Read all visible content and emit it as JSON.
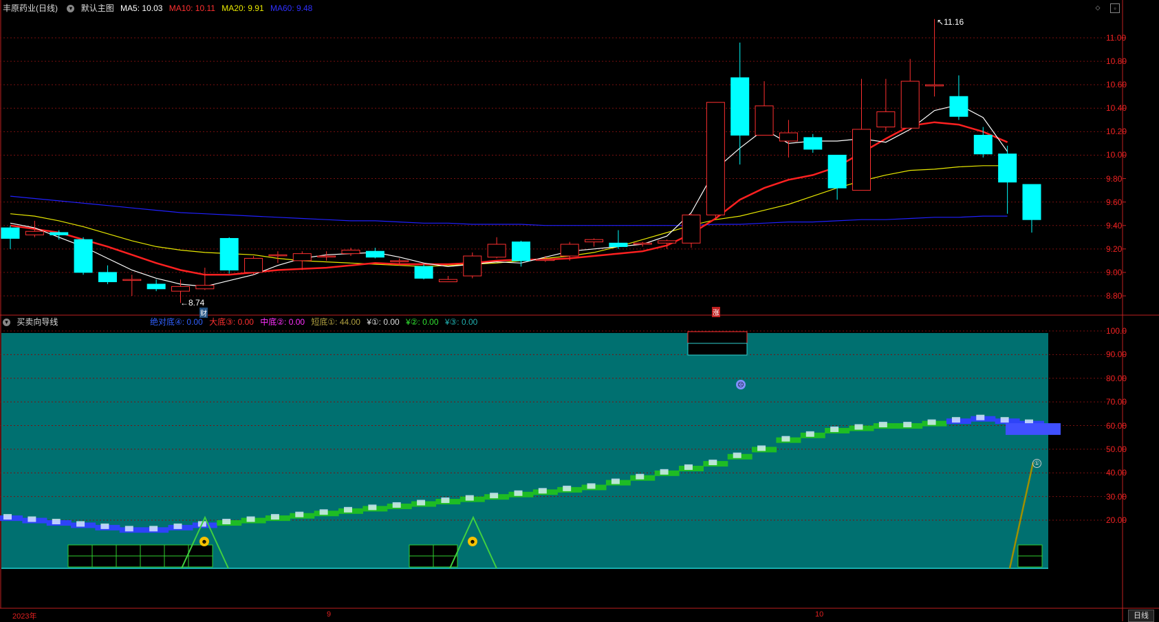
{
  "top_header": {
    "stock": "丰原药业(日线)",
    "chart_name": "默认主图",
    "ma5": "MA5: 10.03",
    "ma10": "MA10: 10.11",
    "ma20": "MA20: 9.91",
    "ma60": "MA60: 9.48"
  },
  "sub_header": {
    "indicator": "买卖向导线",
    "v1": "绝对底④: 0.00",
    "v2": "大底③: 0.00",
    "v3": "中底②: 0.00",
    "v4": "短底①: 44.00",
    "v5": "¥①: 0.00",
    "v6": "¥②: 0.00",
    "v7": "¥③: 0.00"
  },
  "colors": {
    "ma5": "#ffffff",
    "ma10": "#ff2020",
    "ma20": "#e8e800",
    "ma60": "#2020ff",
    "up": "#ff3030",
    "down": "#00ffff",
    "panel": "#007070"
  },
  "price_axis": [
    "11.00",
    "10.80",
    "10.60",
    "10.40",
    "10.20",
    "10.00",
    "9.80",
    "9.60",
    "9.40",
    "9.20",
    "9.00",
    "8.80"
  ],
  "indicator_axis": [
    "100.0",
    "90.00",
    "80.00",
    "70.00",
    "60.00",
    "50.00",
    "40.00",
    "30.00",
    "20.00"
  ],
  "date_labels": [
    "2023年",
    "9",
    "10"
  ],
  "annotations": {
    "high": "11.16",
    "low": "8.74",
    "cai": "财",
    "zhang": "涨",
    "marker1": "①"
  },
  "period_button": "日线",
  "chart_data": {
    "type": "candlestick",
    "ylim": [
      8.7,
      11.2
    ],
    "candles": [
      [
        9.38,
        9.29,
        9.4,
        9.2
      ],
      [
        9.32,
        9.35,
        9.44,
        9.3
      ],
      [
        9.34,
        9.32,
        9.36,
        9.28
      ],
      [
        9.28,
        9.0,
        9.3,
        8.98
      ],
      [
        9.0,
        8.92,
        9.06,
        8.9
      ],
      [
        8.94,
        8.94,
        8.98,
        8.8
      ],
      [
        8.9,
        8.86,
        8.94,
        8.84
      ],
      [
        8.84,
        8.88,
        8.94,
        8.74
      ],
      [
        8.86,
        8.89,
        9.04,
        8.85
      ],
      [
        9.29,
        9.02,
        9.3,
        8.99
      ],
      [
        9.0,
        9.12,
        9.14,
        8.98
      ],
      [
        9.15,
        9.15,
        9.18,
        9.08
      ],
      [
        9.1,
        9.16,
        9.18,
        9.02
      ],
      [
        9.14,
        9.14,
        9.18,
        9.1
      ],
      [
        9.16,
        9.19,
        9.21,
        9.14
      ],
      [
        9.18,
        9.13,
        9.21,
        9.12
      ],
      [
        9.1,
        9.1,
        9.12,
        9.06
      ],
      [
        9.05,
        8.95,
        9.07,
        8.94
      ],
      [
        8.92,
        8.94,
        8.97,
        8.92
      ],
      [
        8.97,
        9.14,
        9.17,
        8.95
      ],
      [
        9.13,
        9.24,
        9.3,
        9.12
      ],
      [
        9.26,
        9.1,
        9.27,
        9.05
      ],
      [
        9.11,
        9.11,
        9.14,
        9.09
      ],
      [
        9.14,
        9.24,
        9.26,
        9.1
      ],
      [
        9.26,
        9.28,
        9.29,
        9.22
      ],
      [
        9.25,
        9.22,
        9.36,
        9.2
      ],
      [
        9.24,
        9.25,
        9.26,
        9.22
      ],
      [
        9.25,
        9.27,
        9.28,
        9.2
      ],
      [
        9.25,
        9.49,
        9.5,
        9.21
      ],
      [
        9.49,
        10.45,
        10.45,
        9.45
      ],
      [
        10.66,
        10.17,
        10.96,
        9.92
      ],
      [
        10.17,
        10.42,
        10.63,
        10.17
      ],
      [
        10.12,
        10.19,
        10.3,
        9.98
      ],
      [
        10.15,
        10.05,
        10.18,
        10.02
      ],
      [
        10.0,
        9.72,
        10.0,
        9.62
      ],
      [
        9.7,
        10.22,
        10.65,
        9.7
      ],
      [
        10.24,
        10.37,
        10.65,
        10.2
      ],
      [
        10.23,
        10.63,
        10.82,
        10.22
      ],
      [
        10.59,
        10.6,
        11.16,
        10.5
      ],
      [
        10.5,
        10.33,
        10.68,
        10.3
      ],
      [
        10.17,
        10.01,
        10.24,
        9.98
      ],
      [
        10.01,
        9.77,
        10.08,
        9.5
      ],
      [
        9.75,
        9.45,
        9.75,
        9.34
      ]
    ],
    "ma5": [
      9.42,
      9.38,
      9.3,
      9.22,
      9.12,
      9.02,
      8.95,
      8.9,
      8.88,
      8.93,
      8.98,
      9.06,
      9.12,
      9.15,
      9.16,
      9.17,
      9.13,
      9.08,
      9.05,
      9.07,
      9.09,
      9.08,
      9.13,
      9.18,
      9.2,
      9.22,
      9.24,
      9.31,
      9.51,
      9.88,
      10.06,
      10.22,
      10.1,
      10.12,
      10.12,
      10.14,
      10.11,
      10.22,
      10.38,
      10.43,
      10.32,
      10.03
    ],
    "ma10": [
      9.4,
      9.37,
      9.34,
      9.28,
      9.22,
      9.15,
      9.08,
      9.02,
      8.98,
      8.98,
      9.0,
      9.02,
      9.03,
      9.04,
      9.06,
      9.08,
      9.07,
      9.07,
      9.07,
      9.08,
      9.1,
      9.11,
      9.11,
      9.12,
      9.14,
      9.16,
      9.18,
      9.23,
      9.33,
      9.46,
      9.62,
      9.72,
      9.79,
      9.83,
      9.9,
      10.02,
      10.14,
      10.25,
      10.28,
      10.26,
      10.2,
      10.11
    ],
    "ma20": [
      9.5,
      9.48,
      9.44,
      9.39,
      9.33,
      9.27,
      9.22,
      9.19,
      9.17,
      9.16,
      9.15,
      9.12,
      9.1,
      9.09,
      9.08,
      9.07,
      9.06,
      9.05,
      9.06,
      9.07,
      9.08,
      9.1,
      9.12,
      9.14,
      9.17,
      9.22,
      9.28,
      9.34,
      9.4,
      9.45,
      9.48,
      9.53,
      9.58,
      9.65,
      9.72,
      9.78,
      9.83,
      9.87,
      9.88,
      9.9,
      9.91,
      9.91
    ],
    "ma60": [
      9.65,
      9.63,
      9.61,
      9.59,
      9.57,
      9.55,
      9.53,
      9.51,
      9.5,
      9.49,
      9.48,
      9.47,
      9.46,
      9.45,
      9.44,
      9.44,
      9.43,
      9.42,
      9.42,
      9.41,
      9.41,
      9.41,
      9.4,
      9.4,
      9.4,
      9.4,
      9.4,
      9.4,
      9.4,
      9.41,
      9.41,
      9.42,
      9.43,
      9.43,
      9.44,
      9.45,
      9.45,
      9.46,
      9.47,
      9.47,
      9.48,
      9.48
    ]
  }
}
